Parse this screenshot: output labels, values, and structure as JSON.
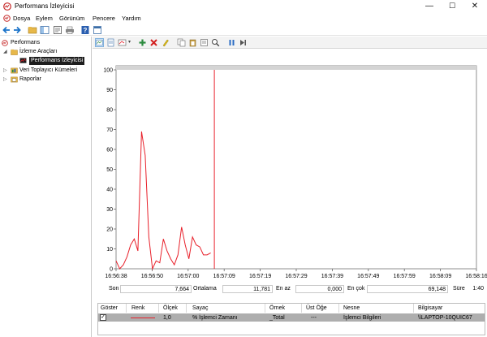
{
  "window": {
    "title": "Performans İzleyicisi",
    "minimize": "—",
    "maximize": "☐",
    "close": "✕"
  },
  "menu": [
    "Dosya",
    "Eylem",
    "Görünüm",
    "Pencere",
    "Yardım"
  ],
  "tree": {
    "root": "Performans",
    "monitoring_tools": "İzleme Araçları",
    "performance_monitor": "Performans İzleyicisi",
    "data_collector_sets": "Veri Toplayıcı Kümeleri",
    "reports": "Raporlar"
  },
  "colors": {
    "series": "#e8202a",
    "tree_selected": "#1e1e1e",
    "counter_row": "#aeaeae",
    "accent": "#1a73c9"
  },
  "chart_data": {
    "type": "line",
    "ylim": [
      0,
      100
    ],
    "y_ticks": [
      "0",
      "10",
      "20",
      "30",
      "40",
      "50",
      "60",
      "70",
      "80",
      "90",
      "100"
    ],
    "x_tick_labels": [
      "16:56:38",
      "16:56:50",
      "16:57:00",
      "16:57:09",
      "16:57:19",
      "16:57:29",
      "16:57:39",
      "16:57:49",
      "16:57:59",
      "16:58:09",
      "16:58:16"
    ],
    "series": [
      {
        "color": "#e8202a",
        "values": [
          4,
          0,
          2,
          6,
          12,
          15,
          9,
          69,
          57,
          16,
          0,
          4,
          3,
          15,
          9,
          5,
          2,
          7,
          21,
          12,
          5,
          16,
          12,
          11,
          7,
          7,
          8
        ]
      }
    ],
    "cursor_at_sample": 27,
    "total_samples": 100
  },
  "stats": {
    "last_label": "Son",
    "last_value": "7,664",
    "avg_label": "Ortalama",
    "avg_value": "11,781",
    "min_label": "En az",
    "min_value": "0,000",
    "max_label": "En çok",
    "max_value": "69,148",
    "duration_label": "Süre",
    "duration_value": "1:40"
  },
  "counters": {
    "headers": [
      "Göster",
      "Renk",
      "Ölçek",
      "Sayaç",
      "Örnek",
      "Üst Öğe",
      "Nesne",
      "Bilgisayar"
    ],
    "row": {
      "show": "✓",
      "scale": "1,0",
      "counter": "% İşlemci Zamanı",
      "instance": "_Total",
      "parent": "---",
      "object": "İşlemci Bilgileri",
      "computer": "\\\\LAPTOP-10QUIC67"
    }
  }
}
